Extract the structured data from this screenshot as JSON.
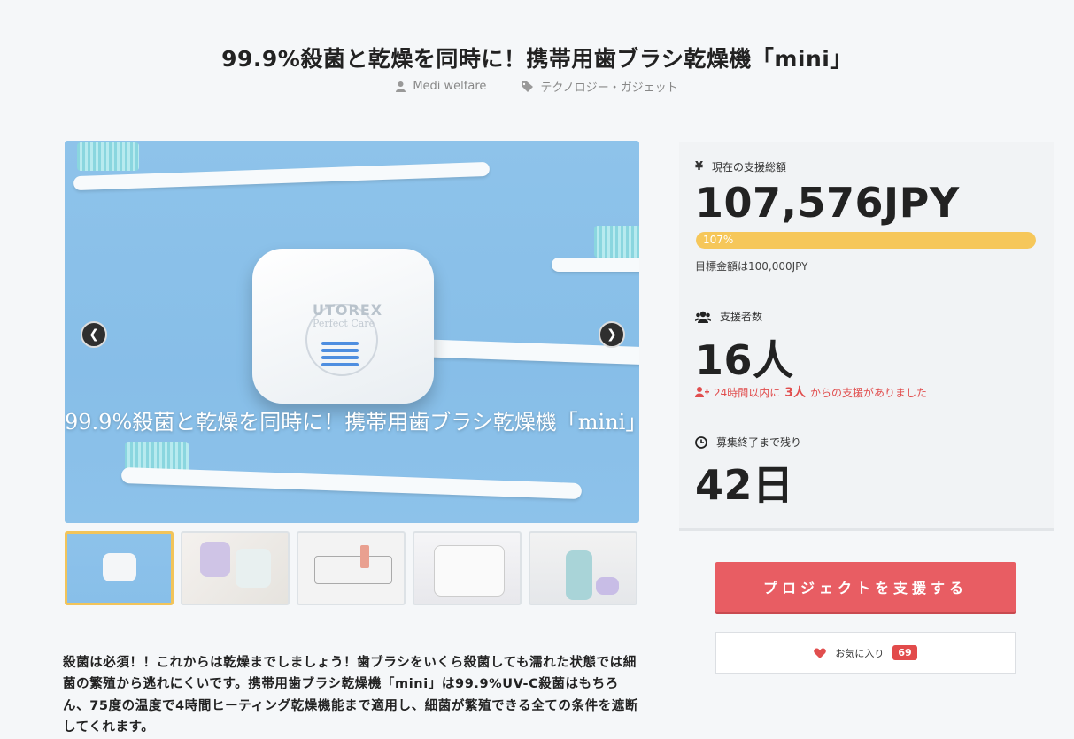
{
  "project": {
    "title": "99.9%殺菌と乾燥を同時に！携帯用歯ブラシ乾燥機「mini」",
    "author": "Medi welfare",
    "category": "テクノロジー・ガジェット"
  },
  "gallery": {
    "hero_caption": "99.9%殺菌と乾燥を同時に！携帯用歯ブラシ乾燥機「mini」",
    "device_brand": "UTOREX",
    "device_subbrand": "Perfect Care",
    "thumbnails": [
      "thumb-1",
      "thumb-2",
      "thumb-3",
      "thumb-4",
      "thumb-5"
    ],
    "active_index": 0
  },
  "description": "殺菌は必須！！これからは乾燥までしましょう！歯ブラシをいくら殺菌しても濡れた状態では細菌の繁殖から逃れにくいです。携帯用歯ブラシ乾燥機「mini」は99.9%UV-C殺菌はもちろん、75度の温度で4時間ヒーティング乾燥機能まで適用し、細菌が繁殖できる全ての条件を遮断してくれます。",
  "stats": {
    "amount_label": "現在の支援総額",
    "amount": "107,576JPY",
    "progress_label": "107%",
    "progress": 1.0,
    "goal_text": "目標金額は100,000JPY",
    "backers_label": "支援者数",
    "backers": "16人",
    "recent_pre": "24時間以内に",
    "recent_count": "3人",
    "recent_post": "からの支援がありました",
    "remaining_label": "募集終了まで残り",
    "remaining": "42日"
  },
  "actions": {
    "support_label": "プロジェクトを支援する",
    "favorite_label": "お気に入り",
    "favorite_count": "69"
  },
  "colors": {
    "accent": "#e85d63",
    "progress": "#f6c75a",
    "alert": "#e14e4e"
  }
}
